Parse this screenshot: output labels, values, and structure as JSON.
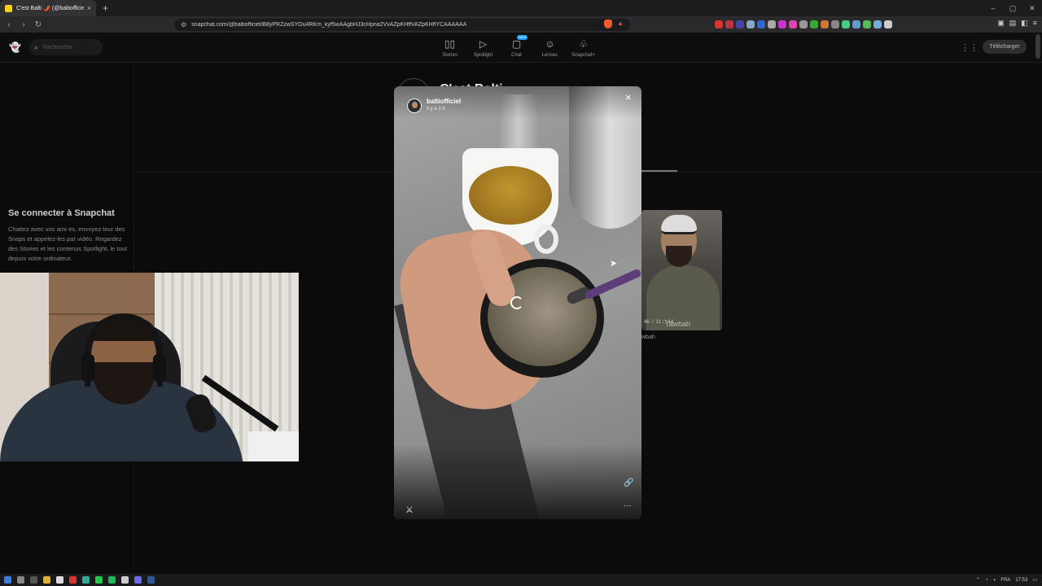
{
  "browser": {
    "tab_title": "C'est Balti 🌶️ (@baltiofficiel) | Sn",
    "tab_close": "×",
    "new_tab": "+",
    "window_controls": [
      "–",
      "▢",
      "✕"
    ],
    "back": "‹",
    "forward": "›",
    "reload": "↻",
    "url": "snapchat.com/@baltiofficiel/B8yPRZzwSYOu4RKm_kyf5wAAgbHJ3cHpna2VvAZpKHffVAZpKHffYCAAAAAA"
  },
  "snapchat": {
    "search_placeholder": "Rechercher",
    "nav": [
      {
        "label": "Stories",
        "icon": "▯▯"
      },
      {
        "label": "Spotlight",
        "icon": "▷"
      },
      {
        "label": "Chat",
        "icon": "▢",
        "badge": "NEW"
      },
      {
        "label": "Lenses",
        "icon": "☺"
      },
      {
        "label": "Snapchat+",
        "icon": "♧"
      }
    ],
    "download_label": "Télécharger",
    "login_title": "Se connecter à Snapchat",
    "login_description": "Chattez avec vos ami·es, envoyez-leur des Snaps et appelez-les par vidéo. Regardez des Stories et les contenus Spotlight, le tout depuis votre ordinateur.",
    "background_profile_name": "C'est Balti"
  },
  "thumbnail": {
    "caption": "Tawbah",
    "stats": "4k  ♡ 11  ◻ 14",
    "name": "wbah"
  },
  "viewer": {
    "username": "baltiofficiel",
    "time": "Il y a 2 h",
    "close": "×",
    "link_icon": "🔗",
    "more_icon": "···",
    "sound_icon": "⚔"
  },
  "taskbar": {
    "language": "FRA",
    "time": "17:53"
  },
  "colors": {
    "accent": "#19a0ff",
    "background": "#0b0b0b"
  }
}
